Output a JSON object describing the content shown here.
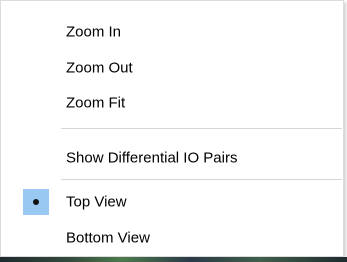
{
  "menu": {
    "items": [
      {
        "label": "Zoom In"
      },
      {
        "label": "Zoom Out"
      },
      {
        "label": "Zoom Fit"
      },
      {
        "label": "Show Differential IO Pairs"
      },
      {
        "label": "Top View",
        "checked": true
      },
      {
        "label": "Bottom View",
        "checked": false
      }
    ]
  },
  "colors": {
    "checked_background": "#99c9f2",
    "separator": "#d7d7d7"
  }
}
